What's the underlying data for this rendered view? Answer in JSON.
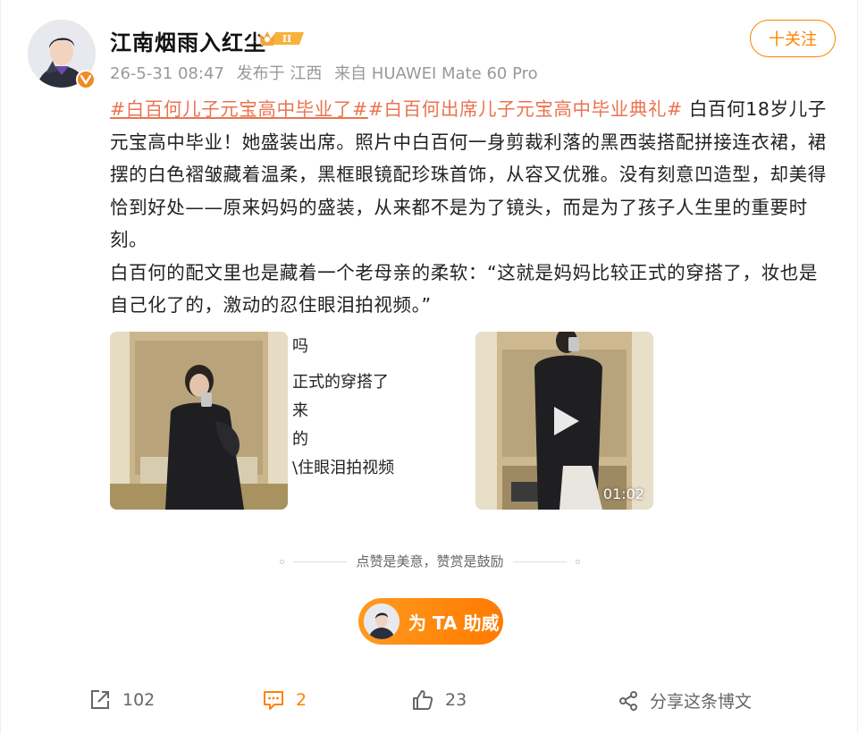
{
  "user": {
    "name": "江南烟雨入红尘",
    "rank": "II",
    "verified_icon": "v-badge-orange"
  },
  "meta": {
    "date": "26-5-31 08:47",
    "location": "发布于 江西",
    "source": "来自 HUAWEI Mate 60 Pro"
  },
  "follow_label": "十关注",
  "post": {
    "tag1": "#白百何儿子元宝高中毕业了#",
    "tag2": "#白百何出席儿子元宝高中毕业典礼#",
    "para1": "白百何18岁儿子元宝高中毕业！她盛装出席。照片中白百何一身剪裁利落的黑西装搭配拼接连衣裙，裙摆的白色褶皱藏着温柔，黑框眼镜配珍珠首饰，从容又优雅。没有刻意凹造型，却美得恰到好处——原来妈妈的盛装，从来都不是为了镜头，而是为了孩子人生里的重要时刻。",
    "para2": "白百何的配文里也是藏着一个老母亲的柔软：“这就是妈妈比较正式的穿搭了，妆也是自己化了的，激动的忍住眼泪拍视频。”"
  },
  "media": {
    "caption_lines": [
      "吗",
      "正式的穿搭了",
      "来",
      "的",
      "\\住眼泪拍视频"
    ],
    "video_duration": "01:02"
  },
  "like_hint": "点赞是美意，赞赏是鼓励",
  "support_label": "为 TA 助威",
  "actions": {
    "repost_count": "102",
    "comment_count": "2",
    "like_count": "23",
    "share_label": "分享这条博文"
  },
  "colors": {
    "accent": "#ff8200",
    "tag": "#eb7350"
  }
}
